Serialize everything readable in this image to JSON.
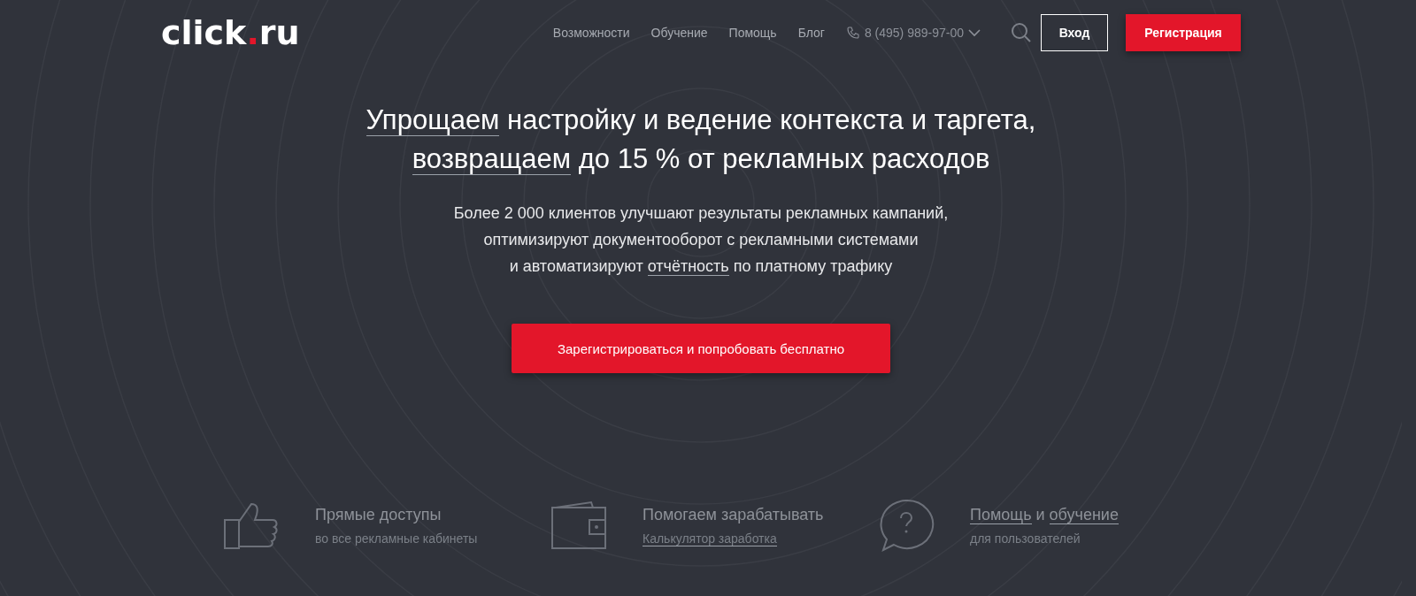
{
  "header": {
    "logo": {
      "text": "click",
      "dot": ".",
      "suffix": "ru"
    },
    "nav": [
      "Возможности",
      "Обучение",
      "Помощь",
      "Блог"
    ],
    "phone": "8 (495) 989-97-00",
    "login": "Вход",
    "register": "Регистрация"
  },
  "hero": {
    "title_lines": [
      [
        {
          "text": "Упрощаем",
          "underlined": true
        },
        {
          "text": " настройку и ведение контекста и таргета,",
          "underlined": false
        }
      ],
      [
        {
          "text": "возвращаем",
          "underlined": true
        },
        {
          "text": " до 15 % от рекламных расходов",
          "underlined": false
        }
      ]
    ],
    "subtitle_lines": [
      [
        {
          "text": "Более 2 000 клиентов улучшают результаты рекламных кампаний,",
          "underlined": false
        }
      ],
      [
        {
          "text": "оптимизируют документооборот с рекламными системами",
          "underlined": false
        }
      ],
      [
        {
          "text": "и автоматизируют ",
          "underlined": false
        },
        {
          "text": "отчётность",
          "underlined": true
        },
        {
          "text": " по платному трафику",
          "underlined": false
        }
      ]
    ],
    "cta": "Зарегистрироваться и попробовать бесплатно"
  },
  "features": [
    {
      "kind": "thumb",
      "title": [
        {
          "text": "Прямые доступы",
          "underlined": false
        }
      ],
      "caption": {
        "text": "во все рекламные кабинеты",
        "underlined": false
      }
    },
    {
      "kind": "wallet",
      "title": [
        {
          "text": "Помогаем зарабатывать",
          "underlined": false
        }
      ],
      "caption": {
        "text": "Калькулятор заработка",
        "underlined": true
      }
    },
    {
      "kind": "help",
      "title": [
        {
          "text": "Помощь",
          "underlined": true
        },
        {
          "text": " и ",
          "underlined": false
        },
        {
          "text": "обучение",
          "underlined": true
        }
      ],
      "caption": {
        "text": "для пользователей",
        "underlined": false
      }
    }
  ]
}
